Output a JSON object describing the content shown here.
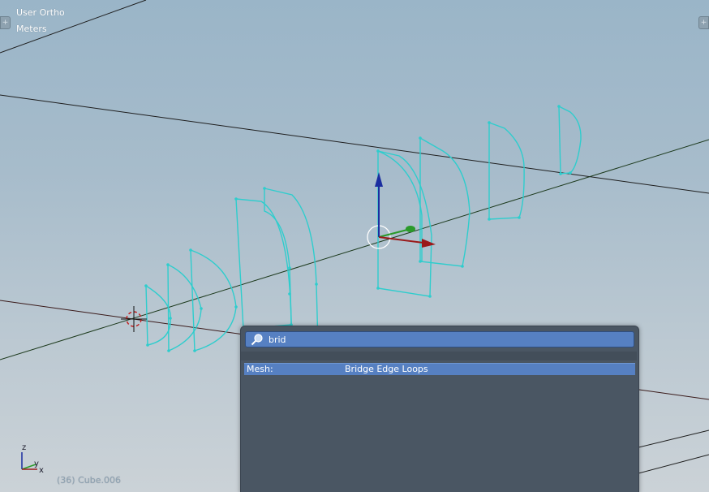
{
  "viewport": {
    "view_name": "User Ortho",
    "units": "Meters",
    "object_info": "(36) Cube.006",
    "axes": {
      "z": "z",
      "y": "y",
      "x": "x"
    }
  },
  "search": {
    "query": "brid",
    "results": [
      {
        "category": "Mesh:",
        "name": "Bridge Edge Loops"
      }
    ]
  },
  "colors": {
    "wire": "#2ecdcd",
    "accent_blue": "#5680c2",
    "popup_bg": "#4a5663",
    "manip_z": "#1a2ea0",
    "manip_y": "#2a9a2a",
    "manip_x": "#9a1a1a"
  },
  "icons": {
    "search": "magnifier-icon",
    "tab_left": "plus-icon",
    "tab_right": "plus-icon"
  }
}
